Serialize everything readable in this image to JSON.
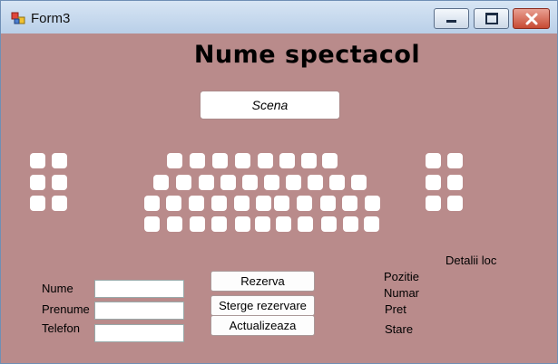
{
  "window": {
    "title": "Form3"
  },
  "heading": "Nume spectacol",
  "stage": {
    "label": "Scena"
  },
  "form": {
    "labels": {
      "nume": "Nume",
      "prenume": "Prenume",
      "telefon": "Telefon"
    },
    "values": {
      "nume": "",
      "prenume": "",
      "telefon": ""
    }
  },
  "buttons": {
    "rezerva": "Rezerva",
    "sterge": "Sterge rezervare",
    "actualizeaza": "Actualizeaza"
  },
  "details": {
    "title": "Detalii loc",
    "labels": {
      "pozitie": "Pozitie",
      "numar": "Numar",
      "pret": "Pret",
      "stare": "Stare"
    }
  }
}
